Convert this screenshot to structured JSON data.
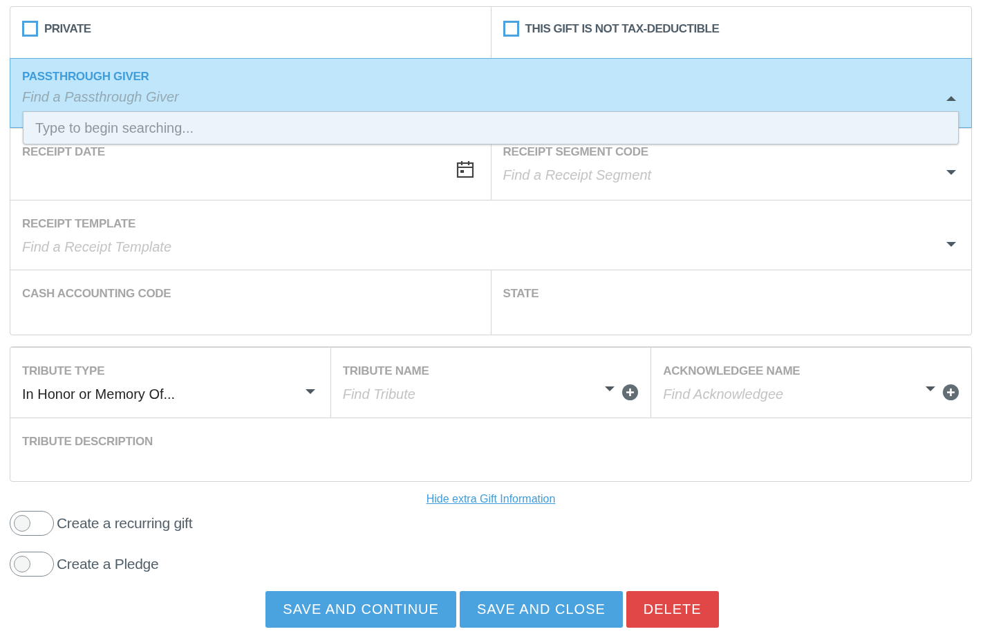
{
  "checkboxes": [
    {
      "label": "PRIVATE",
      "checked": false
    },
    {
      "label": "THIS GIFT IS NOT TAX-DEDUCTIBLE",
      "checked": false
    }
  ],
  "passthrough": {
    "label": "PASSTHROUGH GIVER",
    "placeholder": "Find a Passthrough Giver",
    "expanded": true,
    "search_placeholder": "Type to begin searching..."
  },
  "gift_rows": [
    [
      {
        "label": "RECEIPT DATE",
        "kind": "date"
      },
      {
        "label": "RECEIPT SEGMENT CODE",
        "kind": "select",
        "placeholder": "Find a Receipt Segment"
      }
    ],
    [
      {
        "label": "RECEIPT TEMPLATE",
        "kind": "select",
        "placeholder": "Find a Receipt Template"
      }
    ],
    [
      {
        "label": "CASH ACCOUNTING CODE",
        "kind": "text"
      },
      {
        "label": "STATE",
        "kind": "text"
      }
    ]
  ],
  "tribute_rows": [
    [
      {
        "label": "TRIBUTE TYPE",
        "kind": "select",
        "value": "In Honor or Memory Of..."
      },
      {
        "label": "TRIBUTE NAME",
        "kind": "select-add",
        "placeholder": "Find Tribute"
      },
      {
        "label": "ACKNOWLEDGEE NAME",
        "kind": "select-add",
        "placeholder": "Find Acknowledgee"
      }
    ],
    [
      {
        "label": "TRIBUTE DESCRIPTION",
        "kind": "text"
      }
    ]
  ],
  "link": "Hide extra Gift Information",
  "toggles": [
    {
      "label": "Create a recurring gift",
      "on": false
    },
    {
      "label": "Create a Pledge",
      "on": false
    }
  ],
  "buttons": [
    {
      "label": "SAVE AND CONTINUE",
      "kind": "primary"
    },
    {
      "label": "SAVE AND CLOSE",
      "kind": "primary"
    },
    {
      "label": "DELETE",
      "kind": "danger"
    }
  ]
}
